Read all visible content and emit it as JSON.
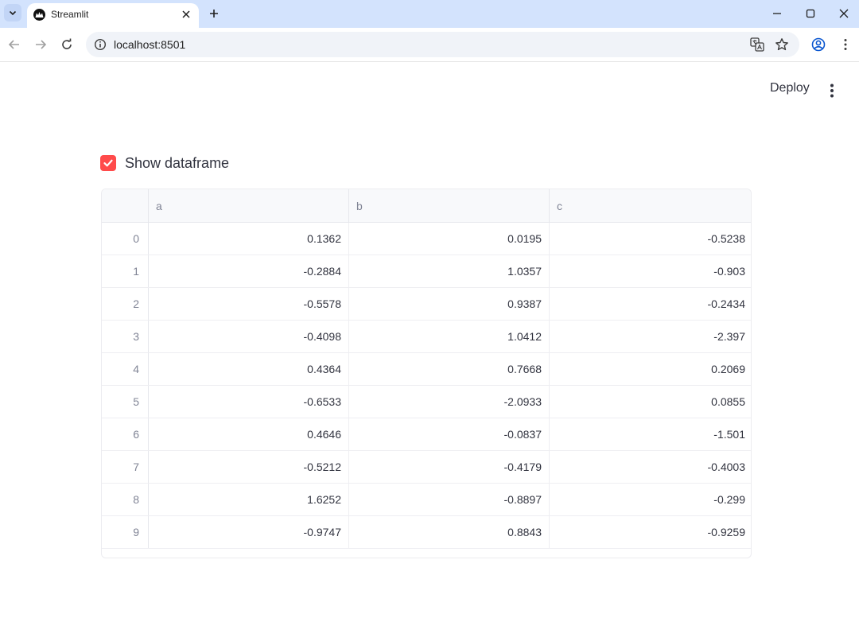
{
  "browser": {
    "tab_title": "Streamlit",
    "url": "localhost:8501"
  },
  "app": {
    "deploy_label": "Deploy",
    "checkbox_label": "Show dataframe",
    "checkbox_checked": true,
    "accent_color": "#ff4b4b"
  },
  "dataframe": {
    "columns": [
      "a",
      "b",
      "c"
    ],
    "rows": [
      {
        "index": "0",
        "a": "0.1362",
        "b": "0.0195",
        "c": "-0.5238"
      },
      {
        "index": "1",
        "a": "-0.2884",
        "b": "1.0357",
        "c": "-0.903"
      },
      {
        "index": "2",
        "a": "-0.5578",
        "b": "0.9387",
        "c": "-0.2434"
      },
      {
        "index": "3",
        "a": "-0.4098",
        "b": "1.0412",
        "c": "-2.397"
      },
      {
        "index": "4",
        "a": "0.4364",
        "b": "0.7668",
        "c": "0.2069"
      },
      {
        "index": "5",
        "a": "-0.6533",
        "b": "-2.0933",
        "c": "0.0855"
      },
      {
        "index": "6",
        "a": "0.4646",
        "b": "-0.0837",
        "c": "-1.501"
      },
      {
        "index": "7",
        "a": "-0.5212",
        "b": "-0.4179",
        "c": "-0.4003"
      },
      {
        "index": "8",
        "a": "1.6252",
        "b": "-0.8897",
        "c": "-0.299"
      },
      {
        "index": "9",
        "a": "-0.9747",
        "b": "0.8843",
        "c": "-0.9259"
      }
    ]
  }
}
